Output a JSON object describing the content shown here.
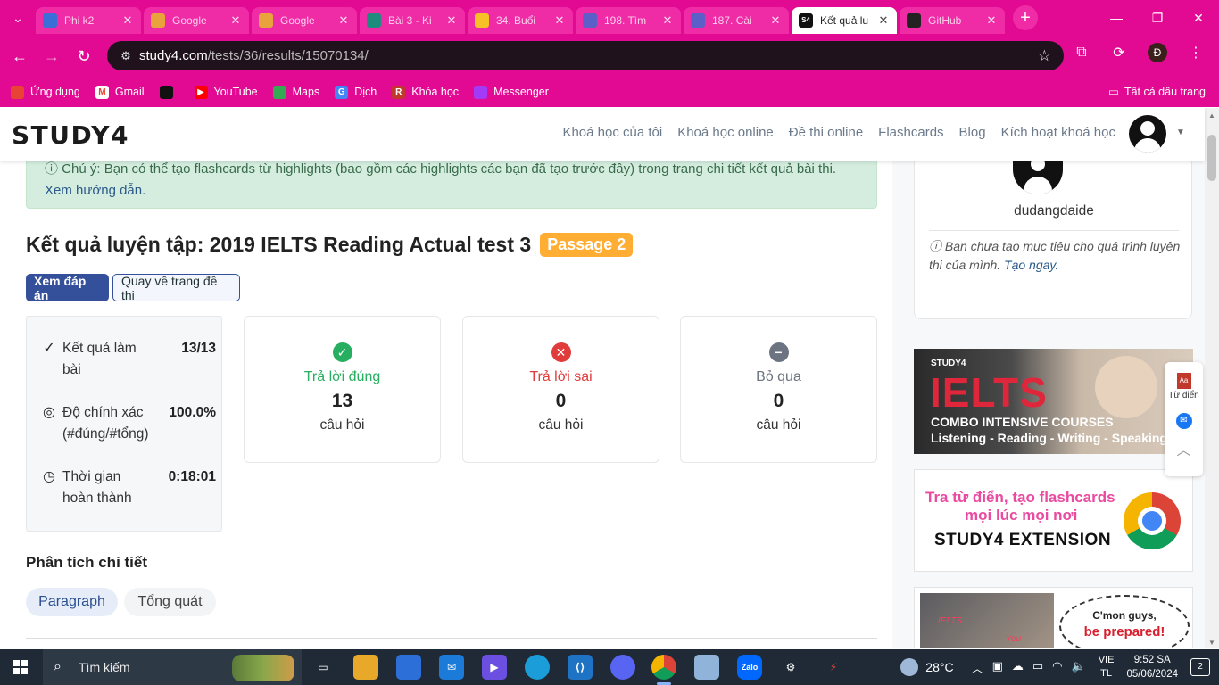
{
  "browser": {
    "tabs": [
      {
        "title": "Phi k2",
        "color": "#3b6fd8",
        "active": false
      },
      {
        "title": "Google",
        "color": "#e8a33d",
        "active": false
      },
      {
        "title": "Google",
        "color": "#e8a33d",
        "active": false
      },
      {
        "title": "Bài 3 - Ki",
        "color": "#1e8b7e",
        "active": false
      },
      {
        "title": "34. Buổi",
        "color": "#f6c026",
        "active": false
      },
      {
        "title": "198. Tìm",
        "color": "#5b5fc7",
        "active": false
      },
      {
        "title": "187. Cài",
        "color": "#5b5fc7",
        "active": false
      },
      {
        "title": "Kết quả lu",
        "color": "#111111",
        "active": true,
        "favtext": "S4"
      },
      {
        "title": "GitHub",
        "color": "#222222",
        "active": false
      }
    ],
    "new_tab_label": "+",
    "url_host": "study4.com",
    "url_path": "/tests/36/results/15070134/",
    "profile_initial": "Đ"
  },
  "bookmarks": {
    "items": [
      {
        "label": "Ứng dụng",
        "color": "#e94335"
      },
      {
        "label": "Gmail",
        "color": "#ffffff",
        "glyph": "M"
      },
      {
        "label": "",
        "color": "#111111"
      },
      {
        "label": "YouTube",
        "color": "#ff0000",
        "glyph": "▶"
      },
      {
        "label": "Maps",
        "color": "#34a853"
      },
      {
        "label": "Dịch",
        "color": "#4285f4",
        "glyph": "G"
      },
      {
        "label": "Khóa học",
        "color": "#c0392b",
        "glyph": "R"
      },
      {
        "label": "Messenger",
        "color": "#a33bf6"
      }
    ],
    "all_bookmarks": "Tất cả dấu trang"
  },
  "site": {
    "logo": "STUDY4",
    "nav": [
      "Khoá học của tôi",
      "Khoá học online",
      "Đề thi online",
      "Flashcards",
      "Blog",
      "Kích hoạt khoá học"
    ]
  },
  "notice": {
    "text": "Chú ý: Bạn có thể tạo flashcards từ highlights (bao gồm các highlights các bạn đã tạo trước đây) trong trang chi tiết kết quả bài thi.",
    "link": "Xem hướng dẫn."
  },
  "result": {
    "title": "Kết quả luyện tập: 2019 IELTS Reading Actual test 3",
    "badge": "Passage 2",
    "btn_answers": "Xem đáp án",
    "btn_back": "Quay về trang đề thi"
  },
  "summary": [
    {
      "label": "Kết quả làm bài",
      "value": "13/13",
      "icon": "✓"
    },
    {
      "label": "Độ chính xác (#đúng/#tổng)",
      "value": "100.0%",
      "icon": "◎"
    },
    {
      "label": "Thời gian hoàn thành",
      "value": "0:18:01",
      "icon": "◷"
    }
  ],
  "stats": [
    {
      "label": "Trả lời đúng",
      "count": "13",
      "unit": "câu hỏi",
      "color": "#27ae60",
      "glyph": "✓"
    },
    {
      "label": "Trả lời sai",
      "count": "0",
      "unit": "câu hỏi",
      "color": "#e03c3c",
      "glyph": "✕"
    },
    {
      "label": "Bỏ qua",
      "count": "0",
      "unit": "câu hỏi",
      "color": "#6b7480",
      "glyph": "−"
    }
  ],
  "analysis": {
    "title": "Phân tích chi tiết",
    "tabs": [
      "Paragraph",
      "Tổng quát"
    ]
  },
  "sidebar": {
    "username": "dudangdaide",
    "goal_text": "Bạn chưa tạo mục tiêu cho quá trình luyện thi của mình.",
    "goal_link": "Tạo ngay."
  },
  "ads": {
    "ielts_brand": "STUDY4",
    "ielts_big": "IELTS",
    "ielts_combo": "COMBO INTENSIVE COURSES",
    "ielts_skills": "Listening - Reading - Writing - Speaking",
    "ext_line1": "Tra từ điển, tạo flashcards",
    "ext_line2": "mọi lúc mọi nơi",
    "ext_line3": "STUDY4 EXTENSION",
    "dog_bubble1": "C'mon guys,",
    "dog_bubble2": "be prepared!",
    "dog_tag1": "IELTS",
    "dog_tag2": "You"
  },
  "float_tools": {
    "dict_label": "Từ điển"
  },
  "taskbar": {
    "search_placeholder": "Tìm kiếm",
    "temperature": "28°C",
    "lang_line1": "VIE",
    "lang_line2": "TL",
    "time": "9:52 SA",
    "date": "05/06/2024",
    "notifications": "2"
  }
}
